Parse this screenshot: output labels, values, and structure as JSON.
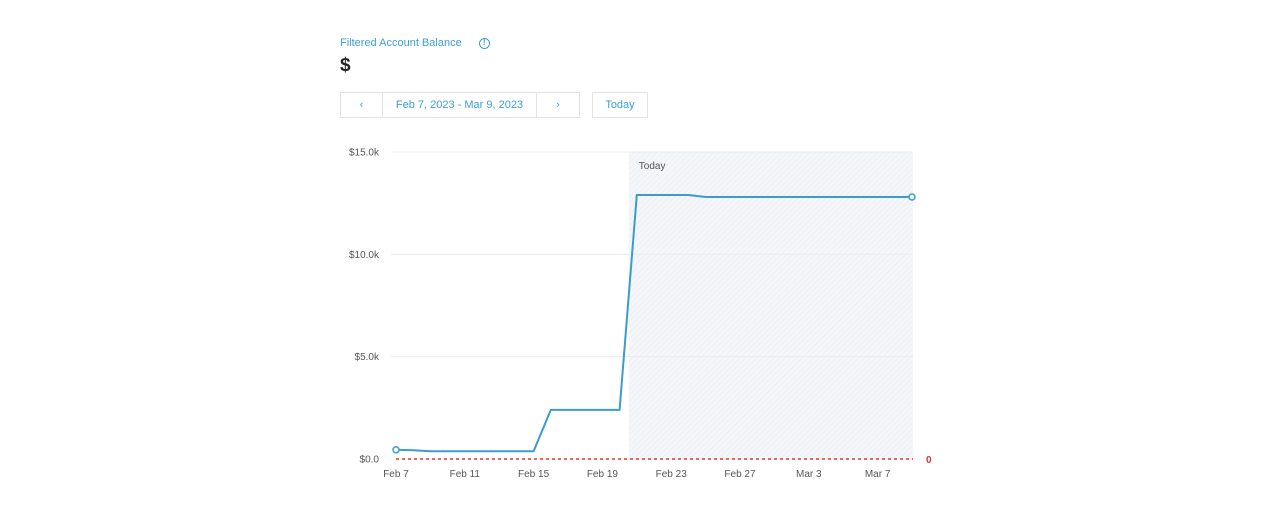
{
  "header": {
    "title": "Filtered Account Balance",
    "info_icon": "info-circle-icon",
    "info_glyph": "!",
    "balance": "$"
  },
  "date_nav": {
    "prev_label": "‹",
    "range_label": "Feb 7, 2023 - Mar 9, 2023",
    "next_label": "›",
    "today_label": "Today"
  },
  "chart_data": {
    "type": "line",
    "title": "",
    "xlabel": "",
    "ylabel": "",
    "ylim": [
      0,
      15000
    ],
    "y_ticks": [
      {
        "value": 0,
        "label": "$0.0"
      },
      {
        "value": 5000,
        "label": "$5.0k"
      },
      {
        "value": 10000,
        "label": "$10.0k"
      },
      {
        "value": 15000,
        "label": "$15.0k"
      }
    ],
    "x_range": [
      "2023-02-07",
      "2023-03-09"
    ],
    "x_ticks": [
      {
        "date": "2023-02-07",
        "label": "Feb 7"
      },
      {
        "date": "2023-02-11",
        "label": "Feb 11"
      },
      {
        "date": "2023-02-15",
        "label": "Feb 15"
      },
      {
        "date": "2023-02-19",
        "label": "Feb 19"
      },
      {
        "date": "2023-02-23",
        "label": "Feb 23"
      },
      {
        "date": "2023-02-27",
        "label": "Feb 27"
      },
      {
        "date": "2023-03-03",
        "label": "Mar 3"
      },
      {
        "date": "2023-03-07",
        "label": "Mar 7"
      }
    ],
    "grid": true,
    "today": {
      "date": "2023-02-21",
      "label": "Today"
    },
    "zero_line": {
      "value": 0,
      "label": "0",
      "color": "#d9362b"
    },
    "series": [
      {
        "color": "#3b9ccf",
        "points": [
          {
            "x": "2023-02-07",
            "y": 450
          },
          {
            "x": "2023-02-08",
            "y": 430
          },
          {
            "x": "2023-02-09",
            "y": 380
          },
          {
            "x": "2023-02-15",
            "y": 380
          },
          {
            "x": "2023-02-16",
            "y": 2400
          },
          {
            "x": "2023-02-20",
            "y": 2400
          },
          {
            "x": "2023-02-21",
            "y": 12900
          },
          {
            "x": "2023-02-24",
            "y": 12900
          },
          {
            "x": "2023-02-25",
            "y": 12800
          },
          {
            "x": "2023-03-09",
            "y": 12800
          }
        ]
      }
    ]
  }
}
